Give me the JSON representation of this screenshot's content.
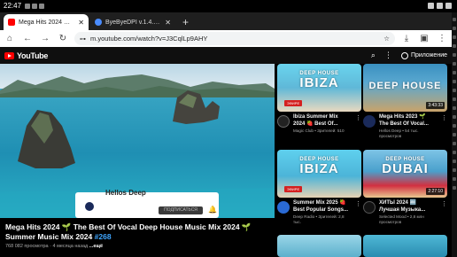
{
  "status": {
    "time": "22:47"
  },
  "tabs": [
    {
      "label": "Mega Hits 2024 🌱 The Best",
      "active": true,
      "favicon_color": "#ff0000"
    },
    {
      "label": "ByeByeDPI v.1.4.7.apk – Rut",
      "active": false,
      "favicon_color": "#4a8cff"
    }
  ],
  "toolbar": {
    "url": "m.youtube.com/watch?v=J3CqlLp9AHY"
  },
  "youtube": {
    "logo_text": "YouTube",
    "signin_label": "Приложение"
  },
  "player": {
    "channel_chip_title": "Hellos Deep",
    "subscribe_label": "ПОДПИСАТЬСЯ"
  },
  "video": {
    "title": "Mega Hits 2024 🌱 The Best Of Vocal Deep House Music Mix 2024 🌱 Summer Music Mix 2024 ",
    "hashtag": "#268",
    "meta": "768 082 просмотра · 4 месяца назад",
    "more": "...ещё"
  },
  "recommendations": [
    {
      "thumb_small": "DEEP HOUSE",
      "thumb_big": "IBIZA",
      "badge": "ЭФИРЕ",
      "title": "Ibiza Summer Mix 2024 🍓 Best Of...",
      "sub": "Magic Club • Зрителей: 510",
      "avatar_color": "#222"
    },
    {
      "thumb_small": "",
      "thumb_big": "DEEP HOUSE",
      "duration": "3:43:33",
      "title": "Mega Hits 2023 🌱 The Best Of Vocal...",
      "sub": "Hellos Deep • 54 тыс. просмотров",
      "avatar_color": "#1a2a5a"
    },
    {
      "thumb_small": "DEEP HOUSE",
      "thumb_big": "IBIZA",
      "badge": "ЭФИРЕ",
      "title": "Summer Mix 2025 🍓 Best Popular Songs...",
      "sub": "Deep Radio • Зрителей: 2,8 тыс.",
      "avatar_color": "#2a6ad4"
    },
    {
      "thumb_small": "DEEP HOUSE",
      "thumb_big": "DUBAI",
      "duration": "2:27:10",
      "title": "ХИТЫ 2024 🔤 Лучшая Музыка...",
      "sub": "Selected Mood • 2,8 млн просмотров",
      "avatar_color": "#111"
    }
  ]
}
